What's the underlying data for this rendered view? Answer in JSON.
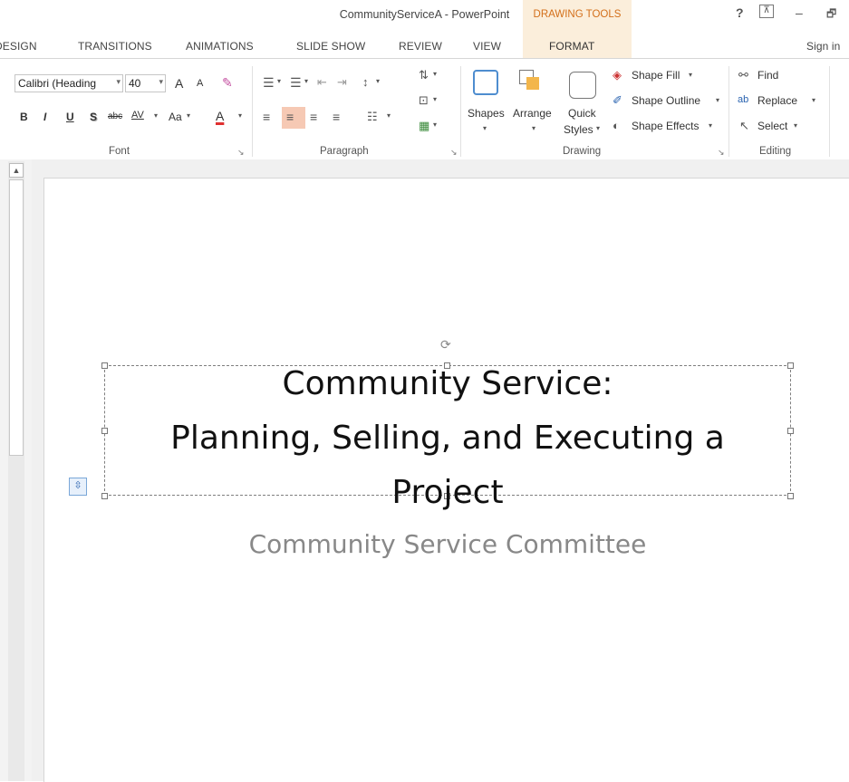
{
  "window": {
    "title": "CommunityServiceA - PowerPoint",
    "context_header": "DRAWING TOOLS",
    "help": "?",
    "ribbon_display": "⊼",
    "minimize": "–",
    "restore": "🗗"
  },
  "tabs": {
    "design": "DESIGN",
    "transitions": "TRANSITIONS",
    "animations": "ANIMATIONS",
    "slide_show": "SLIDE SHOW",
    "review": "REVIEW",
    "view": "VIEW",
    "format": "FORMAT",
    "sign_in": "Sign in"
  },
  "ribbon": {
    "font": {
      "label": "Font",
      "font_name": "Calibri (Heading",
      "font_size": "40",
      "grow": "A",
      "shrink": "A",
      "bold": "B",
      "italic": "I",
      "underline": "U",
      "shadow": "S",
      "strike": "abc",
      "spacing": "AV",
      "case": "Aa",
      "color": "A"
    },
    "paragraph": {
      "label": "Paragraph"
    },
    "drawing": {
      "label": "Drawing",
      "shapes": "Shapes",
      "arrange": "Arrange",
      "quick_styles_1": "Quick",
      "quick_styles_2": "Styles",
      "shape_fill": "Shape Fill",
      "shape_outline": "Shape Outline",
      "shape_effects": "Shape Effects"
    },
    "editing": {
      "label": "Editing",
      "find": "Find",
      "replace": "Replace",
      "select": "Select"
    }
  },
  "slide": {
    "title_line1": "Community Service:",
    "title_line2": "Planning, Selling, and Executing a",
    "title_line3": "Project",
    "subtitle": "Community Service Committee"
  },
  "colors": {
    "accent_orange": "#d36f1a",
    "context_tab_bg": "#fbeedb",
    "font_color_bar": "#e03030"
  }
}
